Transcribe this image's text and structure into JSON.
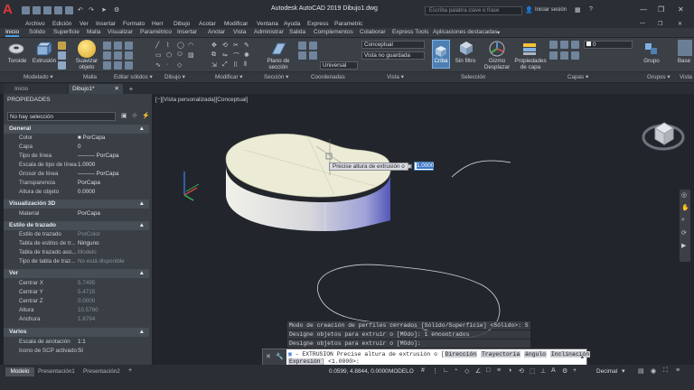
{
  "title_bar": {
    "title": "Autodesk AutoCAD 2019    Dibujo1.dwg",
    "search_placeholder": "Escriba palabra clave o frase",
    "signin": "Iniciar sesión"
  },
  "menu": [
    "Archivo",
    "Edición",
    "Ver",
    "Insertar",
    "Formato",
    "Herr",
    "Dibujo",
    "Acotar",
    "Modificar",
    "Ventana",
    "Ayuda",
    "Express",
    "Parametric"
  ],
  "ribbon_tabs": [
    "Inicio",
    "Sólido",
    "Superficie",
    "Malla",
    "Visualizar",
    "Paramétrico",
    "Insertar",
    "Anotar",
    "Vista",
    "Administrar",
    "Salida",
    "Complementos",
    "Colaborar",
    "Express Tools",
    "Aplicaciones destacadas"
  ],
  "ribbon": {
    "buttons": {
      "toroide": "Toroide",
      "extrusion": "Extrusión",
      "suavizar": "Suavizar objeto",
      "plano": "Plano de sección",
      "criba": "Criba",
      "sinfiltro": "Sin filtro",
      "gizmo": "Gizmo Desplazar",
      "propcapa": "Propiedades de capa",
      "grupo": "Grupo",
      "base": "Base"
    },
    "combos": {
      "visual_style": "Conceptual",
      "view": "Vista no guardada",
      "ucs": "Universal",
      "layer": "0"
    },
    "panels": [
      "Modelado ▾",
      "Malla",
      "Editar sólidos ▾",
      "Dibujo ▾",
      "Modificar ▾",
      "Sección ▾",
      "Coordenadas",
      "Vista ▾",
      "Selección",
      "Capas ▾",
      "Grupos ▾",
      "Vista"
    ]
  },
  "doc_tabs": {
    "start": "Inicio",
    "active": "Dibujo1*",
    "plus": "+"
  },
  "properties": {
    "header": "PROPIEDADES",
    "selection": "No hay selección",
    "sections": {
      "general": "General",
      "vis3d": "Visualización 3D",
      "trazado": "Estilo de trazado",
      "ver": "Ver",
      "varios": "Varios"
    },
    "general": [
      {
        "k": "Color",
        "v": "■ PorCapa"
      },
      {
        "k": "Capa",
        "v": "0"
      },
      {
        "k": "Tipo de línea",
        "v": "——— PorCapa"
      },
      {
        "k": "Escala de tipo de línea",
        "v": "1.0000"
      },
      {
        "k": "Grosor de línea",
        "v": "——— PorCapa"
      },
      {
        "k": "Transparencia",
        "v": "PorCapa"
      },
      {
        "k": "Altura de objeto",
        "v": "0.0000"
      }
    ],
    "vis3d": [
      {
        "k": "Material",
        "v": "PorCapa"
      }
    ],
    "trazado": [
      {
        "k": "Estilo de trazado",
        "v": "PorColor"
      },
      {
        "k": "Tabla de estilos de tr...",
        "v": "Ninguno"
      },
      {
        "k": "Tabla de trazado aso...",
        "v": "Modelo"
      },
      {
        "k": "Tipo de tabla de traz...",
        "v": "No está disponible"
      }
    ],
    "ver": [
      {
        "k": "Centrar X",
        "v": "5.7495"
      },
      {
        "k": "Centrar Y",
        "v": "5.4715"
      },
      {
        "k": "Centrar Z",
        "v": "0.0000"
      },
      {
        "k": "Altura",
        "v": "10.5760"
      },
      {
        "k": "Anchura",
        "v": "1.8794"
      }
    ],
    "varios": [
      {
        "k": "Escala de anotación",
        "v": "1:1"
      },
      {
        "k": "Icono de SCP activado",
        "v": "Sí"
      }
    ]
  },
  "viewport": {
    "label": "[−][Vista personalizada][Conceptual]",
    "tooltip": "Precise altura de extrusión o",
    "input_value": "1.0000",
    "viewcube": "SUPERIOR"
  },
  "command": {
    "history": [
      "Modo de creación de perfiles cerrados [Sólido/Superficie] <Sólido>: S",
      "Designe objetos para extruir o [MOdo]: 1 encontrados",
      "Designe objetos para extruir o [MOdo]:"
    ],
    "prompt_prefix": "- EXTRUSION Precise altura de extrusión o [",
    "keywords": [
      "Dirección",
      "Trayectoria",
      "ángulo",
      "Inclinación"
    ],
    "line2_kw": "Expresión",
    "line2_rest": "] <1.0000>:"
  },
  "status": {
    "layout_tabs": [
      "Modelo",
      "Presentación1",
      "Presentación2"
    ],
    "coords": "0.0599, 4.8844, 0.0000",
    "mode": "MODELO",
    "units": "Decimal"
  }
}
